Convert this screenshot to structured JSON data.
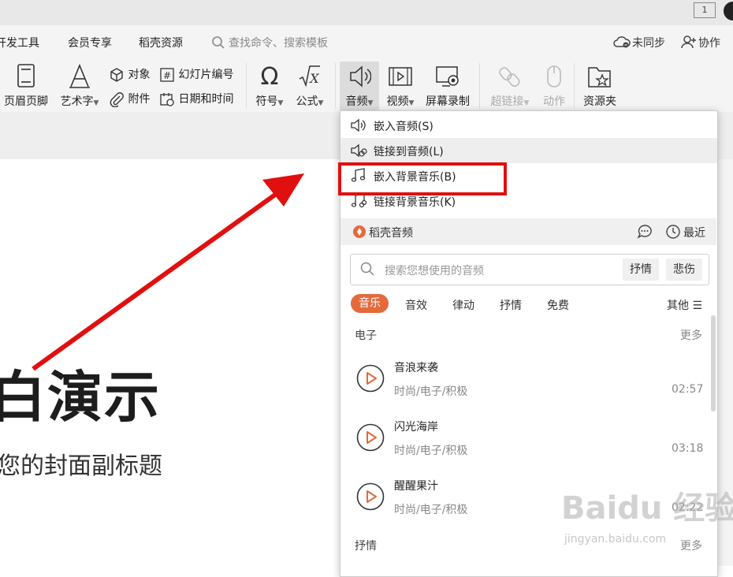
{
  "titlebar": {
    "badge": "1"
  },
  "menu": {
    "dev_tools": "开发工具",
    "member": "会员专享",
    "daoke": "稻壳资源",
    "search_hint": "查找命令、搜索模板",
    "sync": "未同步",
    "collab": "协作"
  },
  "ribbon": {
    "header_footer": "页眉页脚",
    "art_text": "艺术字",
    "object": "对象",
    "slide_number": "幻灯片编号",
    "attachment": "附件",
    "datetime": "日期和时间",
    "symbol": "符号",
    "formula": "公式",
    "audio": "音频",
    "video": "视频",
    "screen_record": "屏幕录制",
    "hyperlink": "超链接",
    "animation": "动作",
    "resource_folder": "资源夹"
  },
  "dropdown": {
    "items": [
      {
        "label": "嵌入音频(S)"
      },
      {
        "label": "链接到音频(L)"
      },
      {
        "label": "嵌入背景音乐(B)"
      },
      {
        "label": "链接背景音乐(K)"
      }
    ],
    "daoke_label": "稻壳音频",
    "recent": "最近",
    "search_placeholder": "搜索您想使用的音频",
    "tag_buttons": [
      "抒情",
      "悲伤"
    ],
    "categories": [
      "音乐",
      "音效",
      "律动",
      "抒情",
      "免费"
    ],
    "other": "其他",
    "section_electronic": "电子",
    "more": "更多",
    "tracks": [
      {
        "name": "音浪来袭",
        "meta": "时尚/电子/积极",
        "duration": "02:57"
      },
      {
        "name": "闪光海岸",
        "meta": "时尚/电子/积极",
        "duration": "03:18"
      },
      {
        "name": "醒醒果汁",
        "meta": "时尚/电子/积极",
        "duration": "02:22"
      }
    ],
    "section_lyric": "抒情",
    "more2": "更多"
  },
  "slide": {
    "title_fragment": "白演示",
    "subtitle_fragment": "您的封面副标题"
  },
  "watermark": {
    "main": "Baidu 经验",
    "sub": "jingyan.baidu.com"
  },
  "colors": {
    "accent": "#e46a3c",
    "highlight_box": "#e01010",
    "arrow": "#e01010"
  }
}
